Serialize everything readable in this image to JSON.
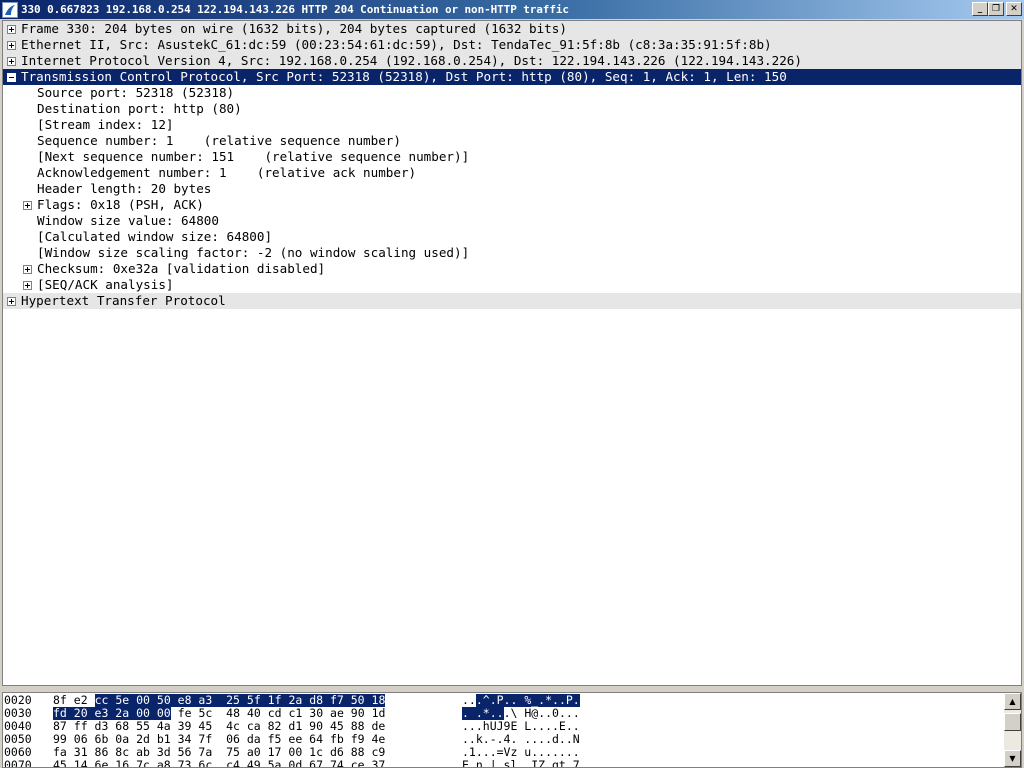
{
  "window": {
    "title": "330 0.667823 192.168.0.254 122.194.143.226 HTTP 204 Continuation or non-HTTP traffic",
    "minimize_glyph": "_",
    "maximize_glyph": "❐",
    "close_glyph": "✕",
    "app_icon": "shark-fin-icon"
  },
  "tree": [
    {
      "text": "Frame 330: 204 bytes on wire (1632 bits), 204 bytes captured (1632 bits)",
      "expander": "plus",
      "level": 0
    },
    {
      "text": "Ethernet II, Src: AsustekC_61:dc:59 (00:23:54:61:dc:59), Dst: TendaTec_91:5f:8b (c8:3a:35:91:5f:8b)",
      "expander": "plus",
      "level": 0
    },
    {
      "text": "Internet Protocol Version 4, Src: 192.168.0.254 (192.168.0.254), Dst: 122.194.143.226 (122.194.143.226)",
      "expander": "plus",
      "level": 0
    },
    {
      "text": "Transmission Control Protocol, Src Port: 52318 (52318), Dst Port: http (80), Seq: 1, Ack: 1, Len: 150",
      "expander": "minus",
      "level": 0,
      "selected": true
    },
    {
      "text": "Source port: 52318 (52318)",
      "expander": "",
      "level": 1
    },
    {
      "text": "Destination port: http (80)",
      "expander": "",
      "level": 1
    },
    {
      "text": "[Stream index: 12]",
      "expander": "",
      "level": 1
    },
    {
      "text": "Sequence number: 1    (relative sequence number)",
      "expander": "",
      "level": 1
    },
    {
      "text": "[Next sequence number: 151    (relative sequence number)]",
      "expander": "",
      "level": 1
    },
    {
      "text": "Acknowledgement number: 1    (relative ack number)",
      "expander": "",
      "level": 1
    },
    {
      "text": "Header length: 20 bytes",
      "expander": "",
      "level": 1
    },
    {
      "text": "Flags: 0x18 (PSH, ACK)",
      "expander": "plus",
      "level": 1
    },
    {
      "text": "Window size value: 64800",
      "expander": "",
      "level": 1
    },
    {
      "text": "[Calculated window size: 64800]",
      "expander": "",
      "level": 1
    },
    {
      "text": "[Window size scaling factor: -2 (no window scaling used)]",
      "expander": "",
      "level": 1
    },
    {
      "text": "Checksum: 0xe32a [validation disabled]",
      "expander": "plus",
      "level": 1
    },
    {
      "text": "[SEQ/ACK analysis]",
      "expander": "plus",
      "level": 1
    },
    {
      "text": "Hypertext Transfer Protocol",
      "expander": "plus",
      "level": 0
    }
  ],
  "hex": [
    {
      "offset": "0020",
      "pre": "8f e2 ",
      "hl": "cc 5e 00 50 e8 a3  25 5f 1f 2a d8 f7 50 18",
      "post": "",
      "ascii_pre": "..",
      "ascii_hl": ".^.P.. %_.*..P."
    },
    {
      "offset": "0030",
      "pre": "",
      "hl": "fd 20 e3 2a 00 00",
      "post": " fe 5c  48 40 cd c1 30 ae 90 1d",
      "ascii_pre": "",
      "ascii_hl": ". .*..",
      "ascii_post": ".\\ H@..0..."
    },
    {
      "offset": "0040",
      "pre": "87 ff d3 68 55 4a 39 45  4c ca 82 d1 90 45 88 de",
      "hl": "",
      "post": "",
      "ascii_pre": "...hUJ9E L....E..",
      "ascii_hl": ""
    },
    {
      "offset": "0050",
      "pre": "99 06 6b 0a 2d b1 34 7f  06 da f5 ee 64 fb f9 4e",
      "hl": "",
      "post": "",
      "ascii_pre": "..k.-.4. ....d..N",
      "ascii_hl": ""
    },
    {
      "offset": "0060",
      "pre": "fa 31 86 8c ab 3d 56 7a  75 a0 17 00 1c d6 88 c9",
      "hl": "",
      "post": "",
      "ascii_pre": ".1...=Vz u.......",
      "ascii_hl": ""
    },
    {
      "offset": "0070",
      "pre": "45 14 6e 16 7c a8 73 6c  c4 49 5a 0d 67 74 ce 37",
      "hl": "",
      "post": "",
      "ascii_pre": "E.n.|.sl .IZ.gt.7",
      "ascii_hl": ""
    }
  ],
  "scrollbar": {
    "up_glyph": "▲",
    "down_glyph": "▼"
  }
}
